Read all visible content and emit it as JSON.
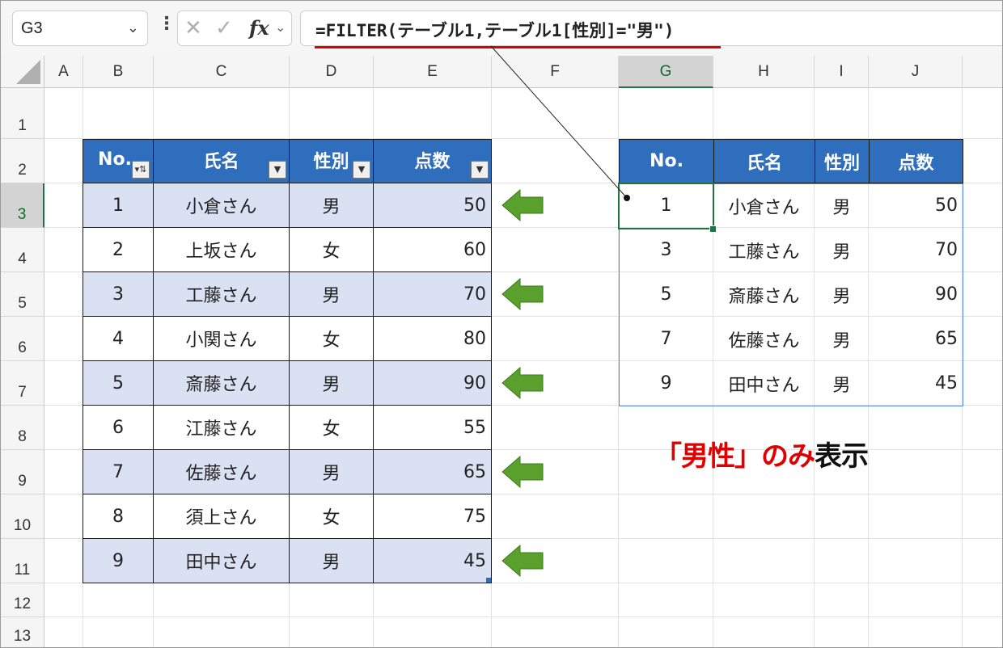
{
  "namebox": {
    "value": "G3"
  },
  "formula": {
    "text": "=FILTER(テーブル1,テーブル1[性別]=\"男\")"
  },
  "columns": [
    "A",
    "B",
    "C",
    "D",
    "E",
    "F",
    "G",
    "H",
    "I",
    "J"
  ],
  "rows": [
    "1",
    "2",
    "3",
    "4",
    "5",
    "6",
    "7",
    "8",
    "9",
    "10",
    "11",
    "12",
    "13"
  ],
  "source_table": {
    "headers": [
      "No.",
      "氏名",
      "性別",
      "点数"
    ],
    "rows": [
      [
        "1",
        "小倉さん",
        "男",
        "50"
      ],
      [
        "2",
        "上坂さん",
        "女",
        "60"
      ],
      [
        "3",
        "工藤さん",
        "男",
        "70"
      ],
      [
        "4",
        "小関さん",
        "女",
        "80"
      ],
      [
        "5",
        "斎藤さん",
        "男",
        "90"
      ],
      [
        "6",
        "江藤さん",
        "女",
        "55"
      ],
      [
        "7",
        "佐藤さん",
        "男",
        "65"
      ],
      [
        "8",
        "須上さん",
        "女",
        "75"
      ],
      [
        "9",
        "田中さん",
        "男",
        "45"
      ]
    ]
  },
  "result_table": {
    "headers": [
      "No.",
      "氏名",
      "性別",
      "点数"
    ],
    "rows": [
      [
        "1",
        "小倉さん",
        "男",
        "50"
      ],
      [
        "3",
        "工藤さん",
        "男",
        "70"
      ],
      [
        "5",
        "斎藤さん",
        "男",
        "90"
      ],
      [
        "7",
        "佐藤さん",
        "男",
        "65"
      ],
      [
        "9",
        "田中さん",
        "男",
        "45"
      ]
    ]
  },
  "note": {
    "part1": "「男性」のみ",
    "part2": "表示"
  },
  "colors": {
    "header_blue": "#2e6ebc",
    "band": "#d9e1f2",
    "arrow_green": "#5aa02c",
    "accent_red": "#e00000",
    "selection_green": "#217346"
  }
}
